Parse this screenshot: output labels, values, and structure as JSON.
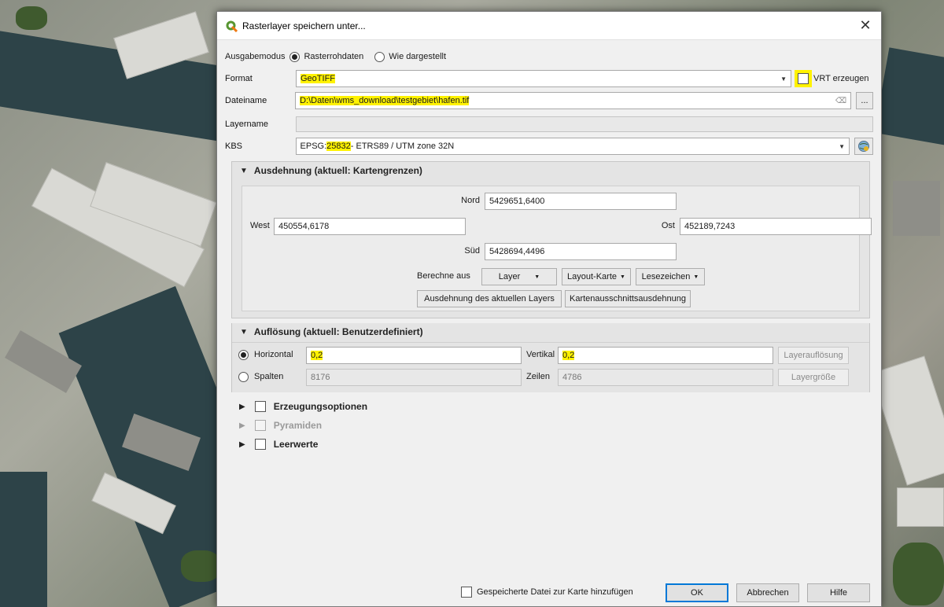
{
  "dialog": {
    "title": "Rasterlayer speichern unter...",
    "app_icon": "qgis-icon",
    "close_glyph": "✕"
  },
  "output_mode": {
    "label": "Ausgabemodus",
    "options": [
      "Rasterrohdaten",
      "Wie dargestellt"
    ],
    "selected": "Rasterrohdaten"
  },
  "format": {
    "label": "Format",
    "value": "GeoTIFF",
    "vrt_label": "VRT erzeugen"
  },
  "filename": {
    "label": "Dateiname",
    "value": "D:\\Daten\\wms_download\\testgebiet\\hafen.tif",
    "browse_label": "..."
  },
  "layername": {
    "label": "Layername",
    "value": ""
  },
  "crs": {
    "label": "KBS",
    "value_prefix": "EPSG:",
    "value_code": "25832",
    "value_suffix": " - ETRS89 / UTM zone 32N"
  },
  "extent": {
    "header": "Ausdehnung (aktuell: Kartengrenzen)",
    "north_label": "Nord",
    "north_value": "5429651,6400",
    "west_label": "West",
    "west_value": "450554,6178",
    "east_label": "Ost",
    "east_value": "452189,7243",
    "south_label": "Süd",
    "south_value": "5428694,4496",
    "calc_from_label": "Berechne aus",
    "layer_btn": "Layer",
    "layout_btn": "Layout-Karte",
    "bookmark_btn": "Lesezeichen",
    "current_layer_btn": "Ausdehnung des aktuellen Layers",
    "canvas_btn": "Kartenausschnittsausdehnung"
  },
  "resolution": {
    "header": "Auflösung (aktuell: Benutzerdefiniert)",
    "horizontal_label": "Horizontal",
    "horizontal_value": "0,2",
    "vertical_label": "Vertikal",
    "vertical_value": "0,2",
    "layer_res_btn": "Layerauflösung",
    "columns_label": "Spalten",
    "columns_value": "8176",
    "rows_label": "Zeilen",
    "rows_value": "4786",
    "layer_size_btn": "Layergröße"
  },
  "sections": {
    "creation_options": "Erzeugungsoptionen",
    "pyramids": "Pyramiden",
    "nodata": "Leerwerte"
  },
  "footer": {
    "add_to_map_label": "Gespeicherte Datei zur Karte hinzufügen",
    "ok": "OK",
    "cancel": "Abbrechen",
    "help": "Hilfe"
  }
}
